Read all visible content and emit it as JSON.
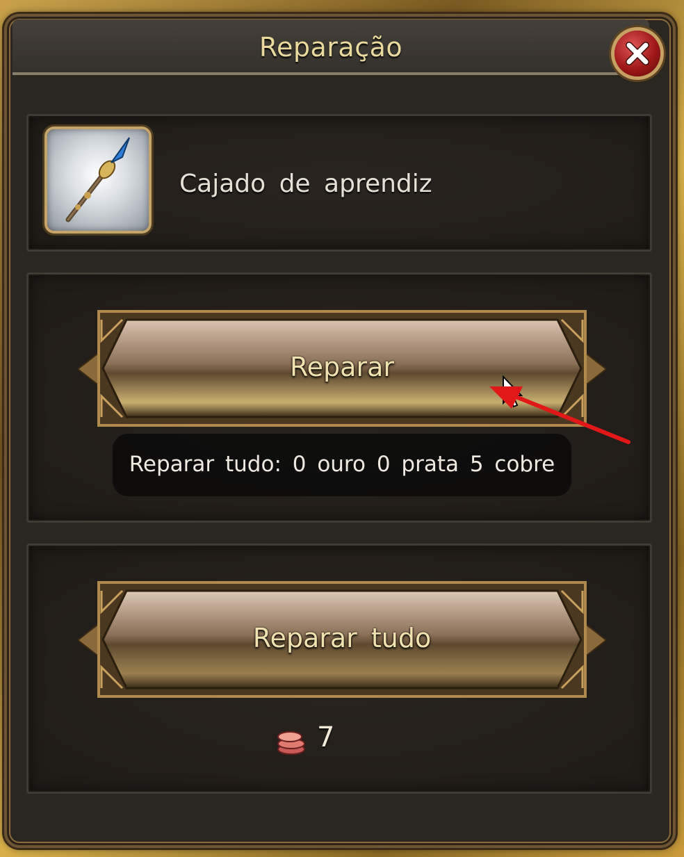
{
  "window": {
    "title": "Reparação",
    "close_icon": "close-x-icon"
  },
  "item": {
    "name": "Cajado de aprendiz",
    "icon": "staff-icon"
  },
  "actions": {
    "repair_label": "Reparar",
    "repair_all_cost": "Reparar tudo: 0 ouro 0 prata 5 cobre",
    "repair_all_label": "Reparar tudo"
  },
  "currency": {
    "icon": "coin-stack-icon",
    "amount": "7"
  },
  "colors": {
    "title_text": "#e9d99f",
    "close_button": "#a01818",
    "annotation_arrow": "#e01818"
  }
}
